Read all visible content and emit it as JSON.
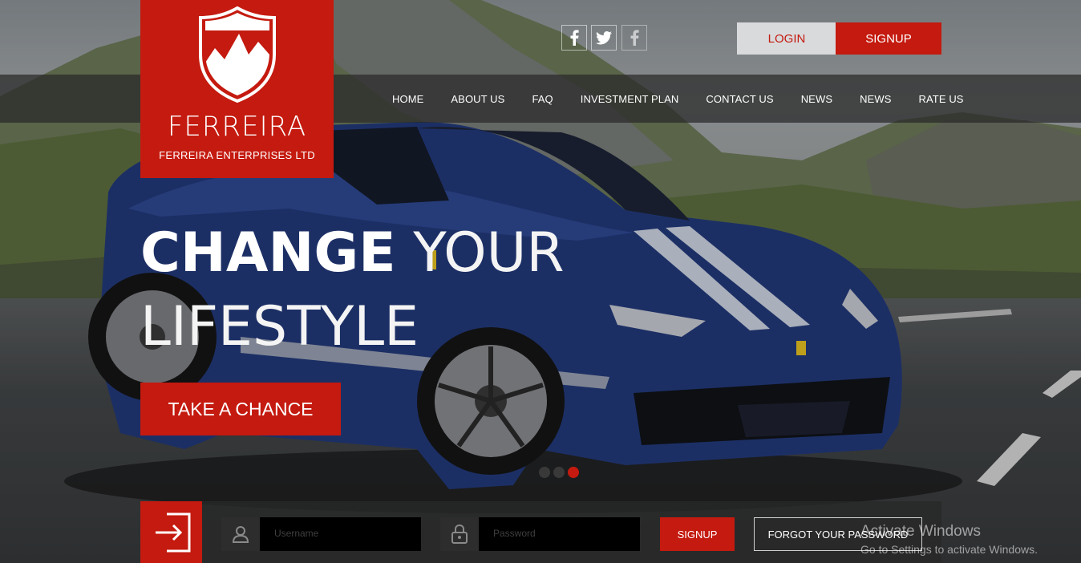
{
  "brand": {
    "name": "FERREIRA",
    "subtitle": "FERREIRA ENTERPRISES LTD",
    "logo_icon": "shield-logo-icon"
  },
  "social": [
    {
      "icon": "facebook-icon"
    },
    {
      "icon": "twitter-icon"
    },
    {
      "icon": "facebook-icon"
    }
  ],
  "auth": {
    "login_label": "LOGIN",
    "signup_label": "SIGNUP"
  },
  "nav": {
    "items": [
      "HOME",
      "ABOUT US",
      "FAQ",
      "INVESTMENT PLAN",
      "CONTACT US",
      "NEWS",
      "NEWS",
      "RATE US"
    ]
  },
  "hero": {
    "title_bold": "CHANGE",
    "title_light_1": "YOUR",
    "title_light_2": "LIFESTYLE",
    "cta_label": "TAKE A CHANCE",
    "slides_count": 3,
    "active_slide": 3
  },
  "login_form": {
    "username_placeholder": "Username",
    "password_placeholder": "Password",
    "submit_label": "SIGNUP",
    "forgot_label": "FORGOT YOUR PASSWORD"
  },
  "os_watermark": {
    "line1": "Activate Windows",
    "line2": "Go to Settings to activate Windows."
  },
  "colors": {
    "accent": "#c41a0f",
    "nav_bg": "#282828",
    "login_bg": "#d9dadc"
  }
}
